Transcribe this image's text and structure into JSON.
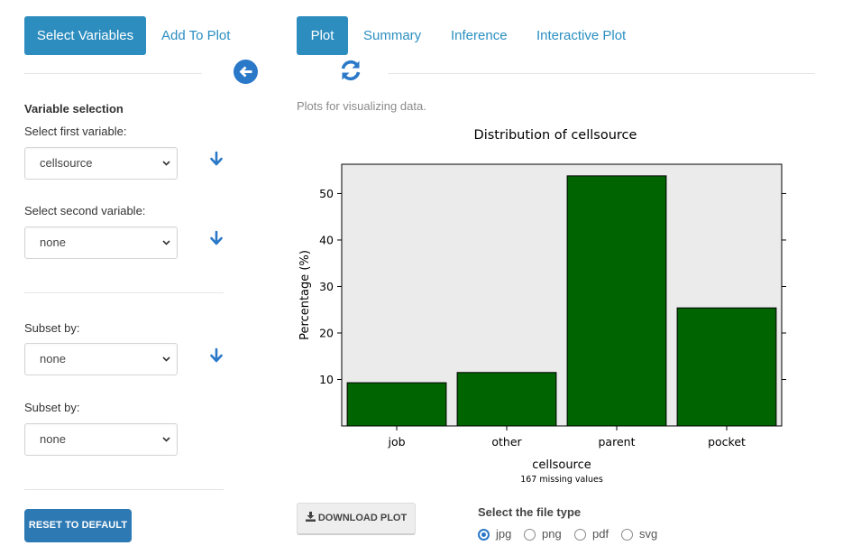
{
  "left_tabs": {
    "select_variables": "Select Variables",
    "add_to_plot": "Add To Plot"
  },
  "right_tabs": {
    "plot": "Plot",
    "summary": "Summary",
    "inference": "Inference",
    "interactive_plot": "Interactive Plot"
  },
  "icons": {
    "back": "arrow-circle-left-icon",
    "refresh": "refresh-icon",
    "move_down": "arrow-down-icon",
    "download": "download-icon",
    "dropdown": "chevron-down-icon"
  },
  "colors": {
    "accent": "#2d8dbf",
    "bar_fill": "#006400",
    "plot_bg": "#ebebeb",
    "reset_button": "#2d79b4"
  },
  "sidebar": {
    "variable_selection_heading": "Variable selection",
    "first_variable_label": "Select first variable:",
    "first_variable_value": "cellsource",
    "second_variable_label": "Select second variable:",
    "second_variable_value": "none",
    "subset1_label": "Subset by:",
    "subset1_value": "none",
    "subset2_label": "Subset by:",
    "subset2_value": "none",
    "reset_button": "RESET TO DEFAULT"
  },
  "main": {
    "description": "Plots for visualizing data.",
    "download_button": "DOWNLOAD PLOT",
    "file_type_label": "Select the file type",
    "file_types": [
      "jpg",
      "png",
      "pdf",
      "svg"
    ],
    "selected_file_type": "jpg"
  },
  "chart_data": {
    "type": "bar",
    "title": "Distribution of cellsource",
    "xlabel": "cellsource",
    "ylabel": "Percentage (%)",
    "subtitle": "167 missing values",
    "categories": [
      "job",
      "other",
      "parent",
      "pocket"
    ],
    "values": [
      9.3,
      11.5,
      53.8,
      25.4
    ],
    "yticks": [
      10,
      20,
      30,
      40,
      50
    ],
    "ylim": [
      0,
      56.3
    ],
    "grid": false
  }
}
